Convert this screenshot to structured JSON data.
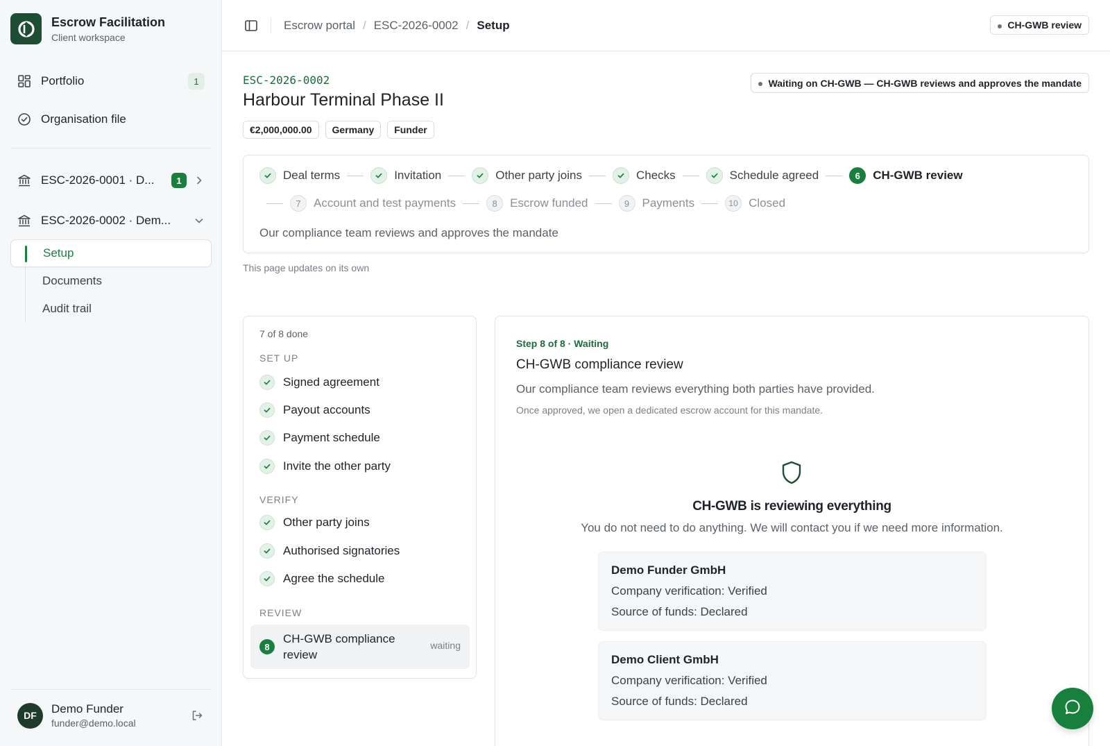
{
  "brand": {
    "title": "Escrow Facilitation",
    "subtitle": "Client workspace"
  },
  "sidebar": {
    "portfolio": {
      "label": "Portfolio",
      "count": "1"
    },
    "organisation": {
      "label": "Organisation file"
    },
    "escrows": [
      {
        "label": "ESC-2026-0001 · D...",
        "count": "1"
      },
      {
        "label": "ESC-2026-0002 · Dem..."
      }
    ],
    "sub_items": [
      "Setup",
      "Documents",
      "Audit trail"
    ]
  },
  "user": {
    "initials": "DF",
    "name": "Demo Funder",
    "email": "funder@demo.local"
  },
  "header": {
    "breadcrumbs": [
      "Escrow portal",
      "ESC-2026-0002",
      "Setup"
    ],
    "status": "CH-GWB review"
  },
  "case": {
    "ref": "ESC-2026-0002",
    "title": "Harbour Terminal Phase II",
    "chips": [
      "€2,000,000.00",
      "Germany",
      "Funder"
    ],
    "waiting": "Waiting on CH-GWB — CH-GWB reviews and approves the mandate"
  },
  "stepper": {
    "row1": [
      {
        "label": "Deal terms",
        "state": "done"
      },
      {
        "label": "Invitation",
        "state": "done"
      },
      {
        "label": "Other party joins",
        "state": "done"
      },
      {
        "label": "Checks",
        "state": "done"
      },
      {
        "label": "Schedule agreed",
        "state": "done"
      },
      {
        "num": "6",
        "label": "CH-GWB review",
        "state": "current"
      }
    ],
    "row2": [
      {
        "num": "7",
        "label": "Account and test payments",
        "state": "todo"
      },
      {
        "num": "8",
        "label": "Escrow funded",
        "state": "todo"
      },
      {
        "num": "9",
        "label": "Payments",
        "state": "todo"
      },
      {
        "num": "10",
        "label": "Closed",
        "state": "todo"
      }
    ],
    "note": "Our compliance team reviews and approves the mandate",
    "updates": "This page updates on its own"
  },
  "checklist": {
    "progress": "7 of 8 done",
    "groups": [
      {
        "title": "SET UP",
        "items": [
          "Signed agreement",
          "Payout accounts",
          "Payment schedule",
          "Invite the other party"
        ]
      },
      {
        "title": "VERIFY",
        "items": [
          "Other party joins",
          "Authorised signatories",
          "Agree the schedule"
        ]
      },
      {
        "title": "REVIEW"
      }
    ],
    "active": {
      "num": "8",
      "label": "CH-GWB compliance review",
      "state": "waiting"
    }
  },
  "detail": {
    "eyebrow": "Step 8 of 8 · Waiting",
    "title": "CH-GWB compliance review",
    "desc": "Our compliance team reviews everything both parties have provided.",
    "note": "Once approved, we open a dedicated escrow account for this mandate.",
    "heading": "CH-GWB is reviewing everything",
    "sub": "You do not need to do anything. We will contact you if we need more information.",
    "parties": [
      {
        "name": "Demo Funder GmbH",
        "verification": "Company verification: Verified",
        "funds": "Source of funds: Declared"
      },
      {
        "name": "Demo Client GmbH",
        "verification": "Company verification: Verified",
        "funds": "Source of funds: Declared"
      }
    ]
  },
  "colors": {
    "accent": "#17803d",
    "brand_dark": "#1d4d33"
  },
  "icons": {
    "logo": "brand-logo-icon",
    "portfolio": "grid-icon",
    "organisation": "check-circle-icon",
    "escrow": "bank-icon",
    "sidebar_toggle": "sidebar-toggle-icon",
    "logout": "logout-icon",
    "shield": "shield-icon",
    "chat": "chat-icon"
  }
}
